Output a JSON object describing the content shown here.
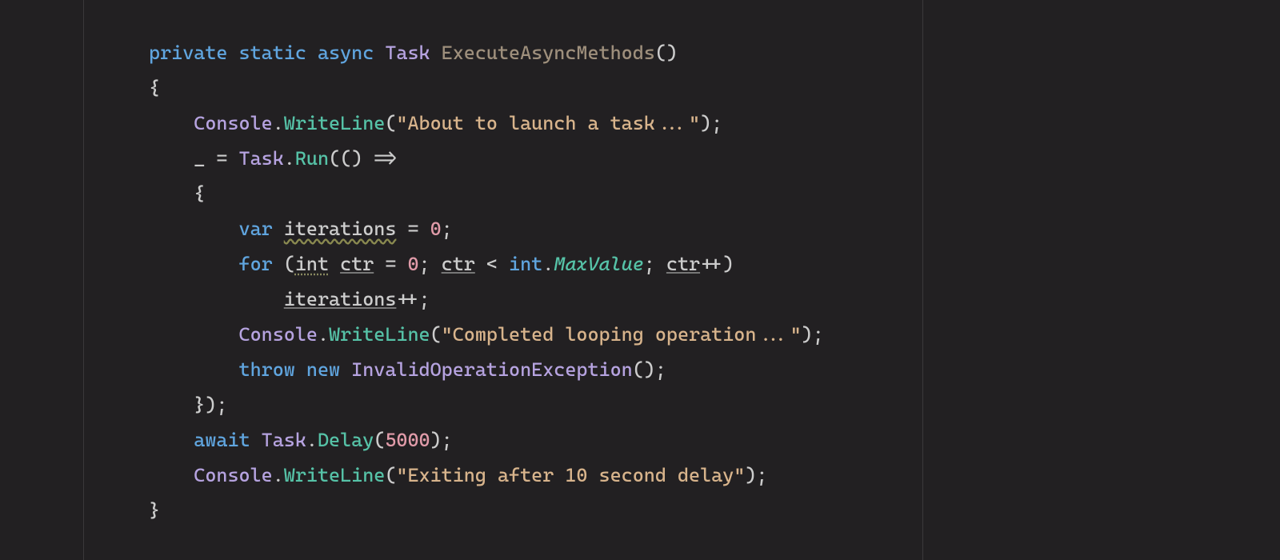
{
  "colors": {
    "background": "#222022",
    "border": "#3a383a",
    "keyword": "#60a5df",
    "type": "#b6a3e0",
    "method_def": "#9e8f7c",
    "member": "#56c2a7",
    "string": "#d8b48c",
    "number": "#e19ba9",
    "default": "#cccccc"
  },
  "code": {
    "lines": [
      {
        "indent": 0,
        "tokens": [
          {
            "t": "private",
            "c": "kw"
          },
          {
            "t": " "
          },
          {
            "t": "static",
            "c": "kw"
          },
          {
            "t": " "
          },
          {
            "t": "async",
            "c": "kw"
          },
          {
            "t": " "
          },
          {
            "t": "Task",
            "c": "type-task"
          },
          {
            "t": " "
          },
          {
            "t": "ExecuteAsyncMethods",
            "c": "method-name"
          },
          {
            "t": "()",
            "c": "punct"
          }
        ]
      },
      {
        "indent": 0,
        "tokens": [
          {
            "t": "{",
            "c": "punct"
          }
        ]
      },
      {
        "indent": 1,
        "tokens": [
          {
            "t": "Console",
            "c": "type-console"
          },
          {
            "t": ".",
            "c": "punct"
          },
          {
            "t": "WriteLine",
            "c": "member-good"
          },
          {
            "t": "(",
            "c": "punct"
          },
          {
            "t": "\"About to launch a task...\"",
            "c": "str"
          },
          {
            "t": ");",
            "c": "punct"
          }
        ]
      },
      {
        "indent": 1,
        "tokens": [
          {
            "t": "_ = ",
            "c": "local"
          },
          {
            "t": "Task",
            "c": "type-task"
          },
          {
            "t": ".",
            "c": "punct"
          },
          {
            "t": "Run",
            "c": "member-good"
          },
          {
            "t": "(() =>",
            "c": "punct"
          }
        ]
      },
      {
        "indent": 1,
        "tokens": [
          {
            "t": "{",
            "c": "punct"
          }
        ]
      },
      {
        "indent": 2,
        "tokens": [
          {
            "t": "var",
            "c": "kw"
          },
          {
            "t": " "
          },
          {
            "t": "iterations",
            "c": "wavy"
          },
          {
            "t": " = ",
            "c": "punct"
          },
          {
            "t": "0",
            "c": "num"
          },
          {
            "t": ";",
            "c": "punct"
          }
        ]
      },
      {
        "indent": 2,
        "tokens": [
          {
            "t": "for",
            "c": "kw"
          },
          {
            "t": " (",
            "c": "punct"
          },
          {
            "t": "int",
            "c": "type-int dimvar"
          },
          {
            "t": " "
          },
          {
            "t": "ctr",
            "c": "underline-gray"
          },
          {
            "t": " = ",
            "c": "punct"
          },
          {
            "t": "0",
            "c": "num"
          },
          {
            "t": "; ",
            "c": "punct"
          },
          {
            "t": "ctr",
            "c": "underline-gray"
          },
          {
            "t": " < ",
            "c": "punct"
          },
          {
            "t": "int",
            "c": "type-int"
          },
          {
            "t": ".",
            "c": "punct"
          },
          {
            "t": "MaxValue",
            "c": "member-static"
          },
          {
            "t": "; ",
            "c": "punct"
          },
          {
            "t": "ctr",
            "c": "underline-gray"
          },
          {
            "t": "++)",
            "c": "punct"
          }
        ]
      },
      {
        "indent": 3,
        "tokens": [
          {
            "t": "iterations",
            "c": "underline-gray"
          },
          {
            "t": "++;",
            "c": "punct"
          }
        ]
      },
      {
        "indent": 2,
        "tokens": [
          {
            "t": "Console",
            "c": "type-console"
          },
          {
            "t": ".",
            "c": "punct"
          },
          {
            "t": "WriteLine",
            "c": "member-good"
          },
          {
            "t": "(",
            "c": "punct"
          },
          {
            "t": "\"Completed looping operation...\"",
            "c": "str"
          },
          {
            "t": ");",
            "c": "punct"
          }
        ]
      },
      {
        "indent": 2,
        "tokens": [
          {
            "t": "throw",
            "c": "kw"
          },
          {
            "t": " "
          },
          {
            "t": "new",
            "c": "kw"
          },
          {
            "t": " "
          },
          {
            "t": "InvalidOperationException",
            "c": "type-task"
          },
          {
            "t": "();",
            "c": "punct"
          }
        ]
      },
      {
        "indent": 1,
        "tokens": [
          {
            "t": "});",
            "c": "punct"
          }
        ]
      },
      {
        "indent": 1,
        "tokens": [
          {
            "t": "await",
            "c": "kw"
          },
          {
            "t": " "
          },
          {
            "t": "Task",
            "c": "type-task"
          },
          {
            "t": ".",
            "c": "punct"
          },
          {
            "t": "Delay",
            "c": "member-good"
          },
          {
            "t": "(",
            "c": "punct"
          },
          {
            "t": "5000",
            "c": "num"
          },
          {
            "t": ");",
            "c": "punct"
          }
        ]
      },
      {
        "indent": 1,
        "tokens": [
          {
            "t": "Console",
            "c": "type-console"
          },
          {
            "t": ".",
            "c": "punct"
          },
          {
            "t": "WriteLine",
            "c": "member-good"
          },
          {
            "t": "(",
            "c": "punct"
          },
          {
            "t": "\"Exiting after 10 second delay\"",
            "c": "str"
          },
          {
            "t": ");",
            "c": "punct"
          }
        ]
      },
      {
        "indent": 0,
        "tokens": [
          {
            "t": "}",
            "c": "punct"
          }
        ]
      }
    ]
  }
}
